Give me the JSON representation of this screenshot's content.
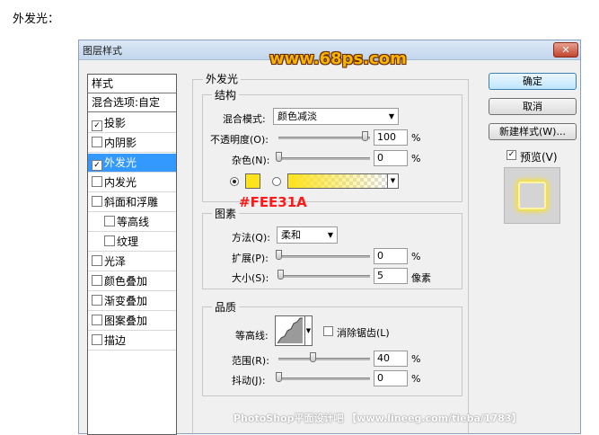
{
  "page_heading": "外发光：",
  "dialog": {
    "title": "图层样式",
    "close_label": "✕",
    "left_panel": {
      "header": "样式",
      "blend_options": "混合选项:自定",
      "items": [
        {
          "label": "投影",
          "checked": true,
          "check_mark": "✓"
        },
        {
          "label": "内阴影",
          "checked": false,
          "check_mark": ""
        },
        {
          "label": "外发光",
          "checked": true,
          "check_mark": "✓",
          "selected": true
        },
        {
          "label": "内发光",
          "checked": false,
          "check_mark": ""
        },
        {
          "label": "斜面和浮雕",
          "checked": false,
          "check_mark": ""
        },
        {
          "label": "等高线",
          "checked": false,
          "check_mark": "",
          "indent": true
        },
        {
          "label": "纹理",
          "checked": false,
          "check_mark": "",
          "indent": true
        },
        {
          "label": "光泽",
          "checked": false,
          "check_mark": ""
        },
        {
          "label": "颜色叠加",
          "checked": false,
          "check_mark": ""
        },
        {
          "label": "渐变叠加",
          "checked": false,
          "check_mark": ""
        },
        {
          "label": "图案叠加",
          "checked": false,
          "check_mark": ""
        },
        {
          "label": "描边",
          "checked": false,
          "check_mark": ""
        }
      ]
    },
    "outer_glow": {
      "section_title": "外发光",
      "structure": {
        "title": "结构",
        "blend_mode_label": "混合模式:",
        "blend_mode_value": "颜色减淡",
        "opacity_label": "不透明度(O):",
        "opacity_value": "100",
        "opacity_unit": "%",
        "opacity_level": 1.0,
        "noise_label": "杂色(N):",
        "noise_value": "0",
        "noise_unit": "%",
        "noise_level": 0.0,
        "glow_color": "#FEE31A",
        "color_annotation": "#FEE31A"
      },
      "elements": {
        "title": "图素",
        "technique_label": "方法(Q):",
        "technique_value": "柔和",
        "spread_label": "扩展(P):",
        "spread_value": "0",
        "spread_unit": "%",
        "spread_level": 0.0,
        "size_label": "大小(S):",
        "size_value": "5",
        "size_unit": "像素",
        "size_level": 0.02
      },
      "quality": {
        "title": "品质",
        "contour_label": "等高线:",
        "anti_alias_label": "消除锯齿(L)",
        "anti_alias_checked": false,
        "range_label": "范围(R):",
        "range_value": "40",
        "range_unit": "%",
        "range_level": 0.4,
        "jitter_label": "抖动(J):",
        "jitter_value": "0",
        "jitter_unit": "%",
        "jitter_level": 0.0
      }
    },
    "buttons": {
      "ok": "确定",
      "cancel": "取消",
      "new_style": "新建样式(W)...",
      "preview_label": "预览(V)",
      "preview_checked": true,
      "preview_check_mark": "✓"
    },
    "watermark_top": "www.68ps.com",
    "watermark_bottom": "PhotoShop平面设计吧 【www.lineeg.com/tieba/1783】"
  },
  "colors": {
    "selection": "#3399ff",
    "glow": "#FEE31A",
    "annotation": "#ff1a1a",
    "watermark_fill": "#f7b500"
  }
}
